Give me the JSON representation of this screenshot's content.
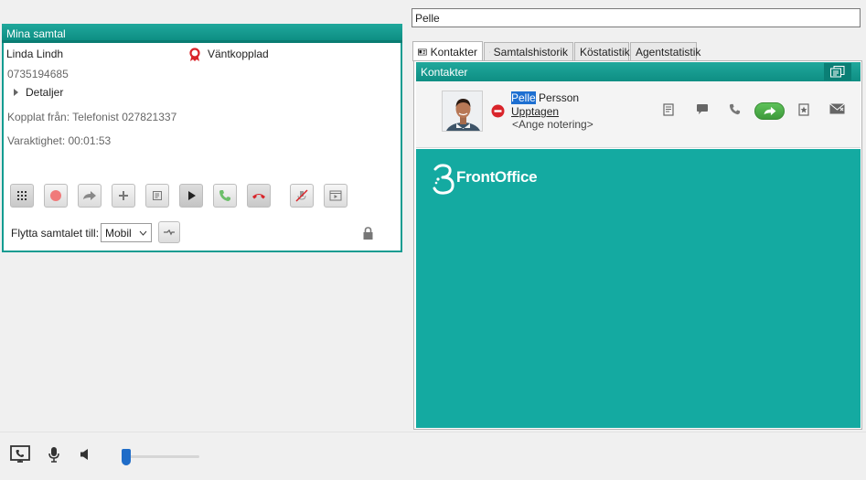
{
  "search": {
    "value": "Pelle"
  },
  "calls_panel": {
    "title": "Mina samtal",
    "caller_name": "Linda Lindh",
    "caller_number": "0735194685",
    "status": "Väntkopplad",
    "details_label": "Detaljer",
    "connected_from": "Kopplat från: Telefonist 027821337",
    "duration": "Varaktighet: 00:01:53",
    "move_call_label": "Flytta samtalet till:",
    "move_call_selected": "Mobil"
  },
  "tabs": [
    {
      "label": "Kontakter",
      "active": true
    },
    {
      "label": "Samtalshistorik",
      "active": false
    },
    {
      "label": "Köstatistik",
      "active": false
    },
    {
      "label": "Agentstatistik",
      "active": false
    }
  ],
  "contacts": {
    "header": "Kontakter",
    "contact": {
      "first_name": "Pelle",
      "last_name": "Persson",
      "status": "Upptagen",
      "note_placeholder": "<Ange notering>"
    }
  },
  "brand": {
    "name": "FrontOffice"
  },
  "colors": {
    "teal_header": "#149c91",
    "teal_brand": "#14aaa1",
    "status_busy": "#d9242a",
    "call_green": "#4caf50",
    "hangup_red": "#d9242a"
  },
  "volume": {
    "level": 0.05
  }
}
